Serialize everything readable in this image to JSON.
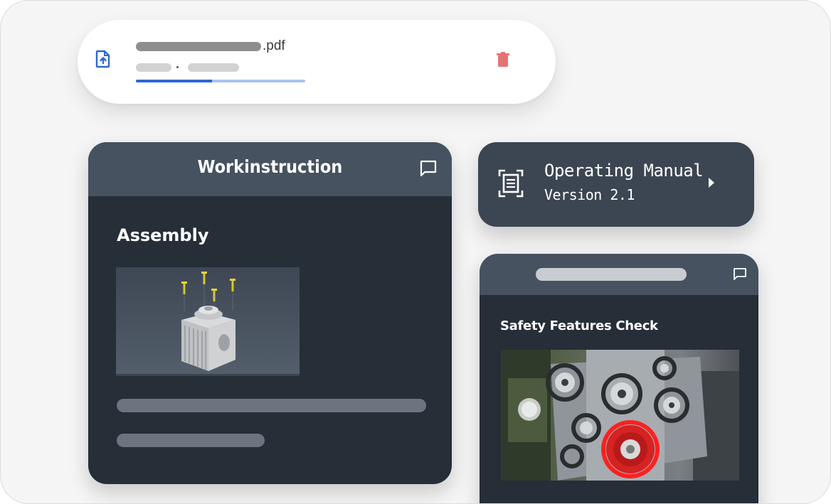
{
  "upload": {
    "file_extension": ".pdf",
    "progress_fraction": 0.45,
    "icons": {
      "file": "file-upload-icon",
      "delete": "trash-icon"
    },
    "colors": {
      "progress": "#2f67d1",
      "progress_track": "#a9c3ee",
      "delete": "#e57373",
      "file_icon": "#2f67d1"
    }
  },
  "workinstruction": {
    "title": "Workinstruction",
    "section_title": "Assembly",
    "icons": {
      "comment": "comment-icon"
    }
  },
  "operating_manual": {
    "title": "Operating Manual",
    "version": "Version 2.1",
    "icons": {
      "scan": "document-scan-icon",
      "open": "play-arrow-icon"
    }
  },
  "safety": {
    "title": "Safety Features Check",
    "icons": {
      "comment": "comment-icon"
    }
  },
  "colors": {
    "card_dark": "#262e38",
    "card_header": "#465260",
    "pill_dark": "#3c4652",
    "background": "#f5f5f6"
  }
}
